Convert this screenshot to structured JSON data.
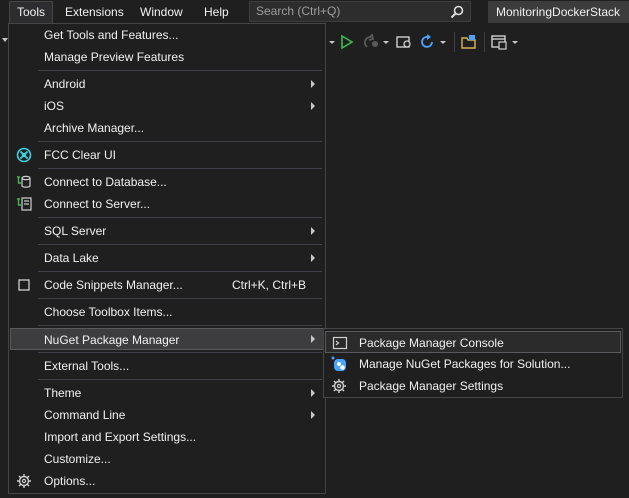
{
  "menubar": {
    "items": [
      {
        "label": "Tools"
      },
      {
        "label": "Extensions"
      },
      {
        "label": "Window"
      },
      {
        "label": "Help"
      }
    ],
    "search_placeholder": "Search (Ctrl+Q)",
    "project_name": "MonitoringDockerStack"
  },
  "tools_menu": {
    "items": [
      {
        "label": "Get Tools and Features...",
        "icon": null,
        "submenu": false
      },
      {
        "label": "Manage Preview Features",
        "icon": null,
        "submenu": false
      },
      {
        "label": "Android",
        "icon": null,
        "submenu": true
      },
      {
        "label": "iOS",
        "icon": null,
        "submenu": true
      },
      {
        "label": "Archive Manager...",
        "icon": null,
        "submenu": false
      },
      {
        "label": "FCC Clear UI",
        "icon": "fcc-icon",
        "submenu": false
      },
      {
        "label": "Connect to Database...",
        "icon": "database-connect-icon",
        "submenu": false
      },
      {
        "label": "Connect to Server...",
        "icon": "server-connect-icon",
        "submenu": false
      },
      {
        "label": "SQL Server",
        "icon": null,
        "submenu": true
      },
      {
        "label": "Data Lake",
        "icon": null,
        "submenu": true
      },
      {
        "label": "Code Snippets Manager...",
        "icon": "snippet-icon",
        "shortcut": "Ctrl+K, Ctrl+B",
        "submenu": false
      },
      {
        "label": "Choose Toolbox Items...",
        "icon": null,
        "submenu": false
      },
      {
        "label": "NuGet Package Manager",
        "icon": null,
        "submenu": true
      },
      {
        "label": "External Tools...",
        "icon": null,
        "submenu": false
      },
      {
        "label": "Theme",
        "icon": null,
        "submenu": true
      },
      {
        "label": "Command Line",
        "icon": null,
        "submenu": true
      },
      {
        "label": "Import and Export Settings...",
        "icon": null,
        "submenu": false
      },
      {
        "label": "Customize...",
        "icon": null,
        "submenu": false
      },
      {
        "label": "Options...",
        "icon": "gear-icon",
        "submenu": false
      }
    ]
  },
  "nuget_submenu": {
    "items": [
      {
        "label": "Package Manager Console",
        "icon": "console-icon"
      },
      {
        "label": "Manage NuGet Packages for Solution...",
        "icon": "nuget-icon"
      },
      {
        "label": "Package Manager Settings",
        "icon": "gear-icon"
      }
    ]
  },
  "colors": {
    "background": "#1f1f1f",
    "menu_border": "#454545",
    "highlight": "#3d3d40",
    "text": "#f1f1f1",
    "accent_cyan": "#3cd2e0",
    "accent_green": "#3fb950",
    "accent_blue": "#4aa3ff"
  }
}
